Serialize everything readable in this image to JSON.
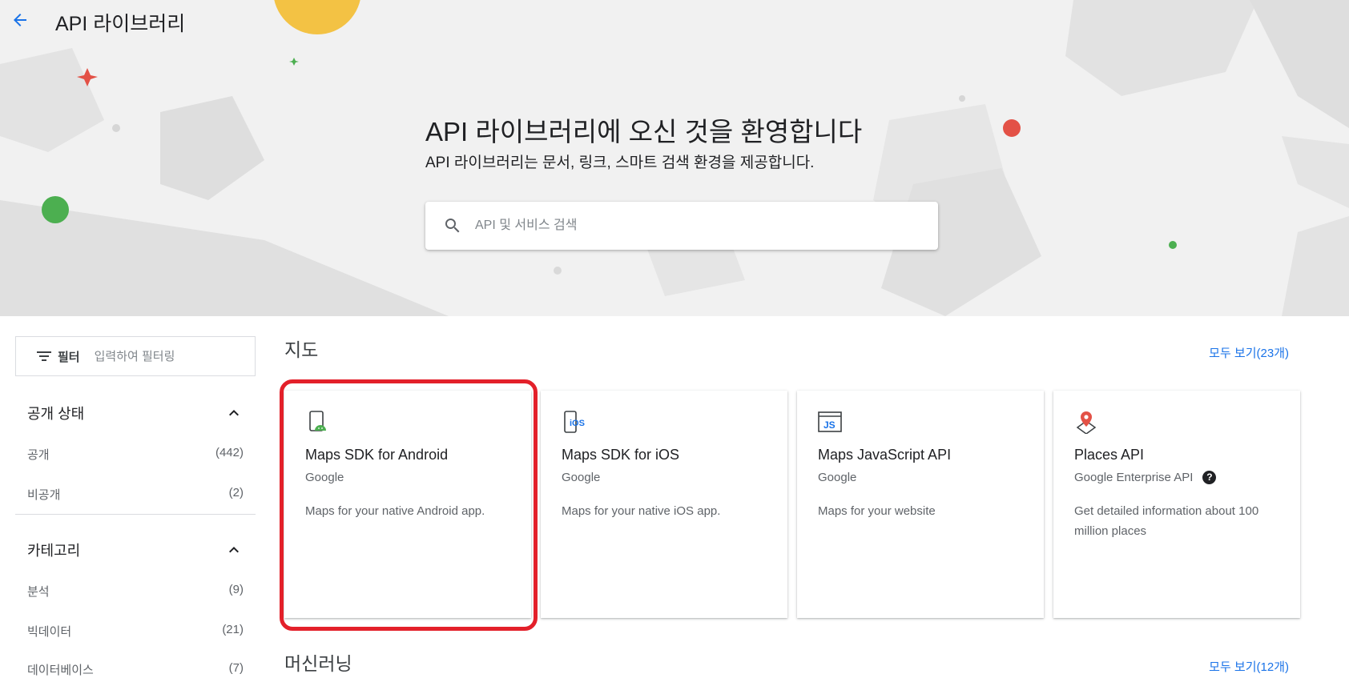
{
  "header": {
    "title": "API 라이브러리",
    "back_icon": "arrow-back-icon"
  },
  "hero": {
    "welcome_title": "API 라이브러리에 오신 것을 환영합니다",
    "welcome_subtitle": "API 라이브러리는 문서, 링크, 스마트 검색 환경을 제공합니다.",
    "search_placeholder": "API 및 서비스 검색",
    "search_icon": "search-icon"
  },
  "sidebar": {
    "filter_label": "필터",
    "filter_placeholder": "입력하여 필터링",
    "facets": [
      {
        "title": "공개 상태",
        "items": [
          {
            "label": "공개",
            "count": "(442)"
          },
          {
            "label": "비공개",
            "count": "(2)"
          }
        ]
      },
      {
        "title": "카테고리",
        "items": [
          {
            "label": "분석",
            "count": "(9)"
          },
          {
            "label": "빅데이터",
            "count": "(21)"
          },
          {
            "label": "데이터베이스",
            "count": "(7)"
          }
        ]
      }
    ]
  },
  "sections": [
    {
      "title": "지도",
      "see_all": "모두 보기(23개)",
      "cards": [
        {
          "name": "Maps SDK for Android",
          "provider": "Google",
          "description": "Maps for your native Android app.",
          "icon": "android-phone-icon"
        },
        {
          "name": "Maps SDK for iOS",
          "provider": "Google",
          "description": "Maps for your native iOS app.",
          "icon": "ios-phone-icon"
        },
        {
          "name": "Maps JavaScript API",
          "provider": "Google",
          "description": "Maps for your website",
          "icon": "js-icon"
        },
        {
          "name": "Places API",
          "provider": "Google Enterprise API",
          "description": "Get detailed information about 100 million places",
          "icon": "place-pin-icon",
          "help": "?"
        }
      ]
    },
    {
      "title": "머신러닝",
      "see_all": "모두 보기(12개)"
    }
  ],
  "colors": {
    "accent": "#1a73e8",
    "highlight": "#e3202a",
    "hero_bg": "#f1f1f1"
  }
}
